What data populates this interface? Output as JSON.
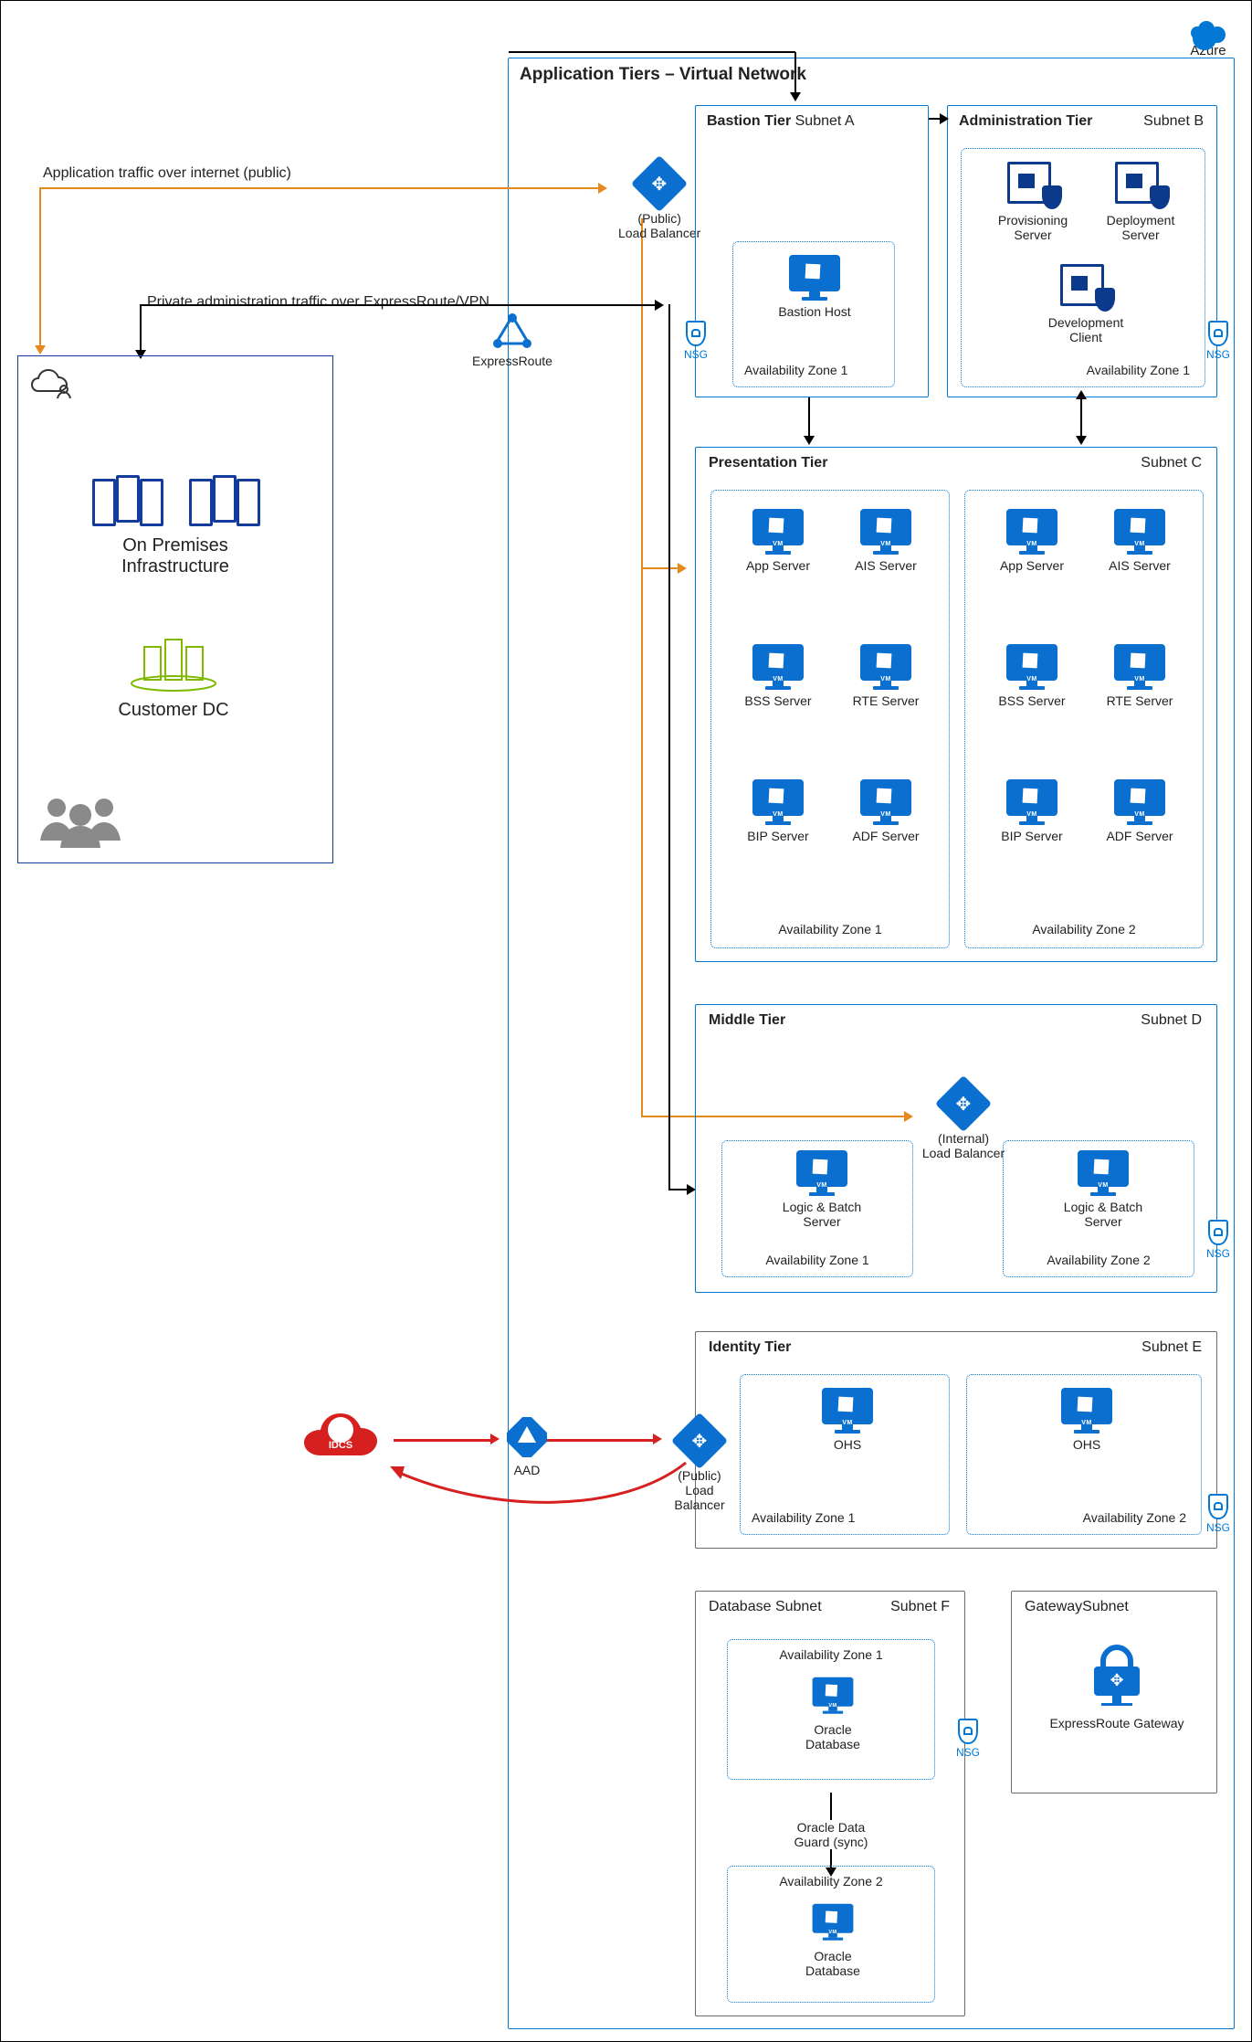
{
  "cloud_brand": "Azure",
  "vnet_title": "Application Tiers – Virtual Network",
  "traffic_public": "Application traffic over internet (public)",
  "traffic_private": "Private administration traffic over ExpressRoute/VPN",
  "load_balancer_public_line1": "(Public)",
  "load_balancer_public_line2": "Load Balancer",
  "express_route": "ExpressRoute",
  "nsg": "NSG",
  "on_prem": {
    "infra_line1": "On Premises",
    "infra_line2": "Infrastructure",
    "dc": "Customer DC"
  },
  "tiers": {
    "bastion": {
      "title_b": "Bastion Tier",
      "title_s": " Subnet A",
      "az": "Availability Zone 1",
      "host": "Bastion Host"
    },
    "admin": {
      "title_b": "Administration Tier",
      "title_s": "Subnet B",
      "az": "Availability Zone 1",
      "prov": "Provisioning Server",
      "deploy": "Deployment Server",
      "dev": "Development Client"
    },
    "pres": {
      "title_b": "Presentation Tier",
      "title_s": "Subnet C",
      "az1": "Availability Zone 1",
      "az2": "Availability Zone 2",
      "app": "App Server",
      "ais": "AIS Server",
      "bss": "BSS Server",
      "rte": "RTE Server",
      "bip": "BIP Server",
      "adf": "ADF Server"
    },
    "mid": {
      "title_b": "Middle Tier",
      "title_s": "Subnet D",
      "az1": "Availability Zone 1",
      "az2": "Availability Zone 2",
      "ilb_line1": "(Internal)",
      "ilb_line2": "Load Balancer",
      "logic": "Logic & Batch Server"
    },
    "id": {
      "title_b": "Identity Tier",
      "title_s": "Subnet E",
      "az1": "Availability Zone 1",
      "az2": "Availability Zone 2",
      "lb_line1": "(Public)",
      "lb_line2": "Load Balancer",
      "ohs": "OHS"
    },
    "db": {
      "title_b": "Database Subnet",
      "title_s": "Subnet F",
      "az1": "Availability Zone 1",
      "az2": "Availability Zone 2",
      "oracle": "Oracle Database",
      "guard_l1": "Oracle Data",
      "guard_l2": "Guard (sync)"
    },
    "gw": {
      "title": "GatewaySubnet",
      "label": "ExpressRoute Gateway"
    }
  },
  "idcs": "IDCS",
  "aad": "AAD"
}
